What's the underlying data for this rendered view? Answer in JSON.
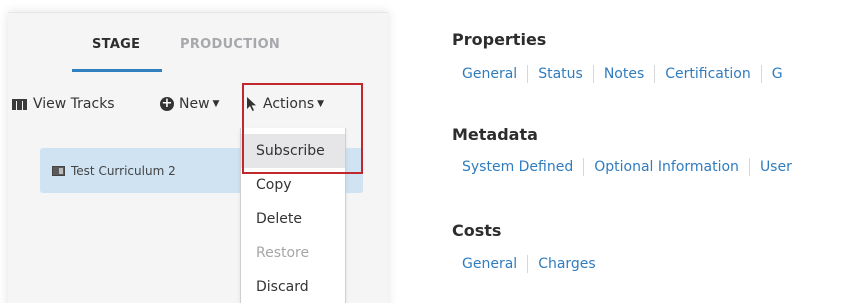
{
  "tabs": [
    {
      "label": "STAGE",
      "active": true
    },
    {
      "label": "PRODUCTION",
      "active": false
    }
  ],
  "toolbar": {
    "view_tracks": "View Tracks",
    "new": "New",
    "actions": "Actions"
  },
  "list": {
    "items": [
      {
        "label": "Test Curriculum 2",
        "icon": "curriculum-icon"
      }
    ]
  },
  "actions_menu": {
    "items": [
      {
        "label": "Subscribe",
        "state": "hover"
      },
      {
        "label": "Copy",
        "state": "enabled"
      },
      {
        "label": "Delete",
        "state": "enabled"
      },
      {
        "label": "Restore",
        "state": "disabled"
      },
      {
        "label": "Discard",
        "state": "enabled"
      }
    ]
  },
  "sections": [
    {
      "title": "Properties",
      "links": [
        "General",
        "Status",
        "Notes",
        "Certification",
        "G"
      ]
    },
    {
      "title": "Metadata",
      "links": [
        "System Defined",
        "Optional Information",
        "User"
      ]
    },
    {
      "title": "Costs",
      "links": [
        "General",
        "Charges"
      ]
    }
  ],
  "colors": {
    "accent_blue": "#2f7cbf",
    "selected_row": "#cfe3f3",
    "highlight_red": "#c0282e",
    "panel_bg": "#f5f5f6"
  }
}
